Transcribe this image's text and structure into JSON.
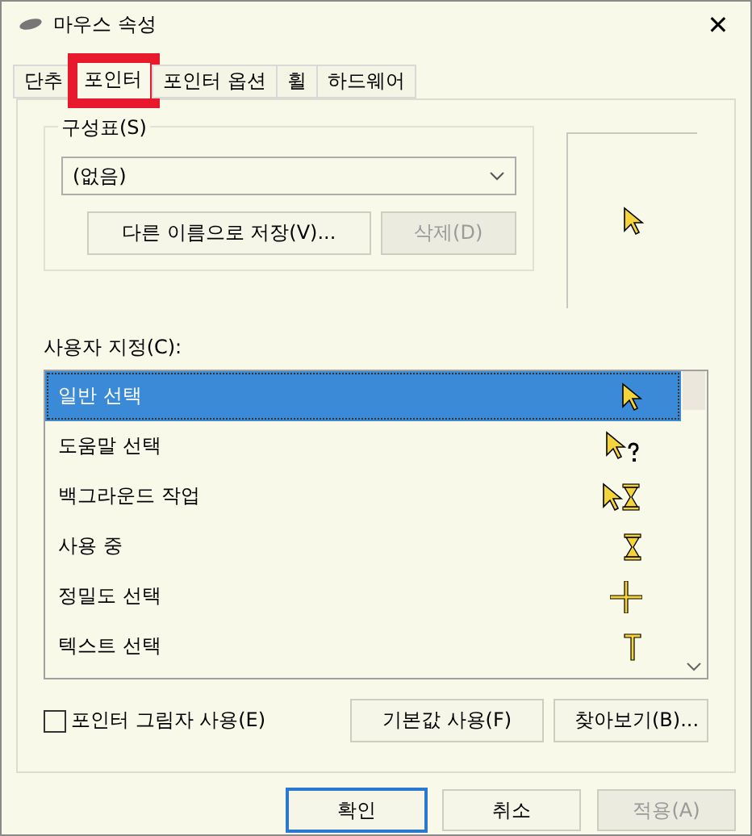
{
  "window": {
    "title": "마우스 속성",
    "close": "✕"
  },
  "tabs": [
    {
      "label": "단추",
      "selected": false,
      "highlighted": false
    },
    {
      "label": "포인터",
      "selected": true,
      "highlighted": true
    },
    {
      "label": "포인터 옵션",
      "selected": false,
      "highlighted": false
    },
    {
      "label": "휠",
      "selected": false,
      "highlighted": false
    },
    {
      "label": "하드웨어",
      "selected": false,
      "highlighted": false
    }
  ],
  "scheme": {
    "label": "구성표(S)",
    "value": "(없음)",
    "buttons": [
      {
        "label": "다른 이름으로 저장(V)...",
        "disabled": false
      },
      {
        "label": "삭제(D)",
        "disabled": true
      }
    ]
  },
  "customize": {
    "label": "사용자 지정(C):",
    "items": [
      {
        "label": "일반 선택",
        "kind": "arrow",
        "selected": true
      },
      {
        "label": "도움말 선택",
        "kind": "help",
        "selected": false
      },
      {
        "label": "백그라운드 작업",
        "kind": "background",
        "selected": false
      },
      {
        "label": "사용 중",
        "kind": "busy",
        "selected": false
      },
      {
        "label": "정밀도 선택",
        "kind": "cross",
        "selected": false
      },
      {
        "label": "텍스트 선택",
        "kind": "text",
        "selected": false
      }
    ]
  },
  "shadow": {
    "label": "포인터 그림자 사용(E)",
    "checked": false
  },
  "pointer_buttons": [
    {
      "label": "기본값 사용(F)"
    },
    {
      "label": "찾아보기(B)..."
    }
  ],
  "dialog_buttons": [
    {
      "label": "확인",
      "default": true,
      "disabled": false
    },
    {
      "label": "취소",
      "default": false,
      "disabled": false
    },
    {
      "label": "적용(A)",
      "default": false,
      "disabled": true
    }
  ]
}
